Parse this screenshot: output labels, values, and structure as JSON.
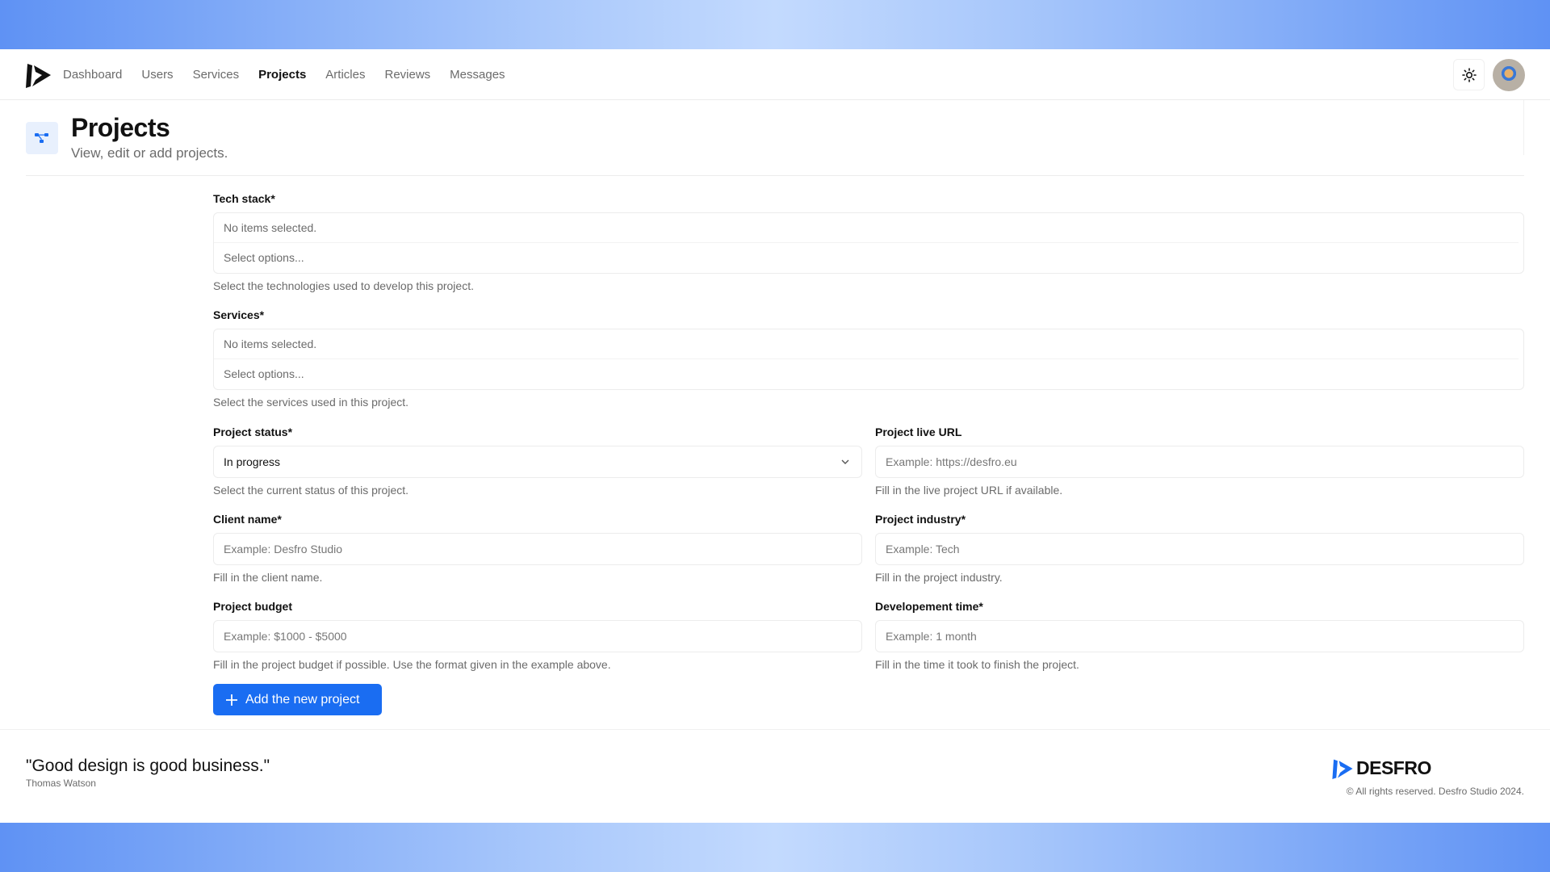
{
  "nav": {
    "items": [
      {
        "label": "Dashboard",
        "active": false
      },
      {
        "label": "Users",
        "active": false
      },
      {
        "label": "Services",
        "active": false
      },
      {
        "label": "Projects",
        "active": true
      },
      {
        "label": "Articles",
        "active": false
      },
      {
        "label": "Reviews",
        "active": false
      },
      {
        "label": "Messages",
        "active": false
      }
    ],
    "theme_icon": "sun-icon"
  },
  "header": {
    "title": "Projects",
    "subtitle": "View, edit or add projects.",
    "icon": "project-nodes-icon"
  },
  "form": {
    "tech_stack": {
      "label": "Tech stack*",
      "selected": "No items selected.",
      "placeholder": "Select options...",
      "help": "Select the technologies used to develop this project."
    },
    "services": {
      "label": "Services*",
      "selected": "No items selected.",
      "placeholder": "Select options...",
      "help": "Select the services used in this project."
    },
    "status": {
      "label": "Project status*",
      "value": "In progress",
      "help": "Select the current status of this project."
    },
    "live_url": {
      "label": "Project live URL",
      "placeholder": "Example: https://desfro.eu",
      "help": "Fill in the live project URL if available."
    },
    "client": {
      "label": "Client name*",
      "placeholder": "Example: Desfro Studio",
      "help": "Fill in the client name."
    },
    "industry": {
      "label": "Project industry*",
      "placeholder": "Example: Tech",
      "help": "Fill in the project industry."
    },
    "budget": {
      "label": "Project budget",
      "placeholder": "Example: $1000 - $5000",
      "help": "Fill in the project budget if possible. Use the format given in the example above."
    },
    "dev_time": {
      "label": "Developement time*",
      "placeholder": "Example: 1 month",
      "help": "Fill in the time it took to finish the project."
    },
    "submit_label": "Add the new project"
  },
  "footer": {
    "quote": "\"Good design is good business.\"",
    "author": "Thomas Watson",
    "brand": "DESFRO",
    "copyright": "© All rights reserved. Desfro Studio 2024."
  },
  "colors": {
    "accent": "#1a6df2",
    "icon_bg": "#e8f0fd"
  }
}
